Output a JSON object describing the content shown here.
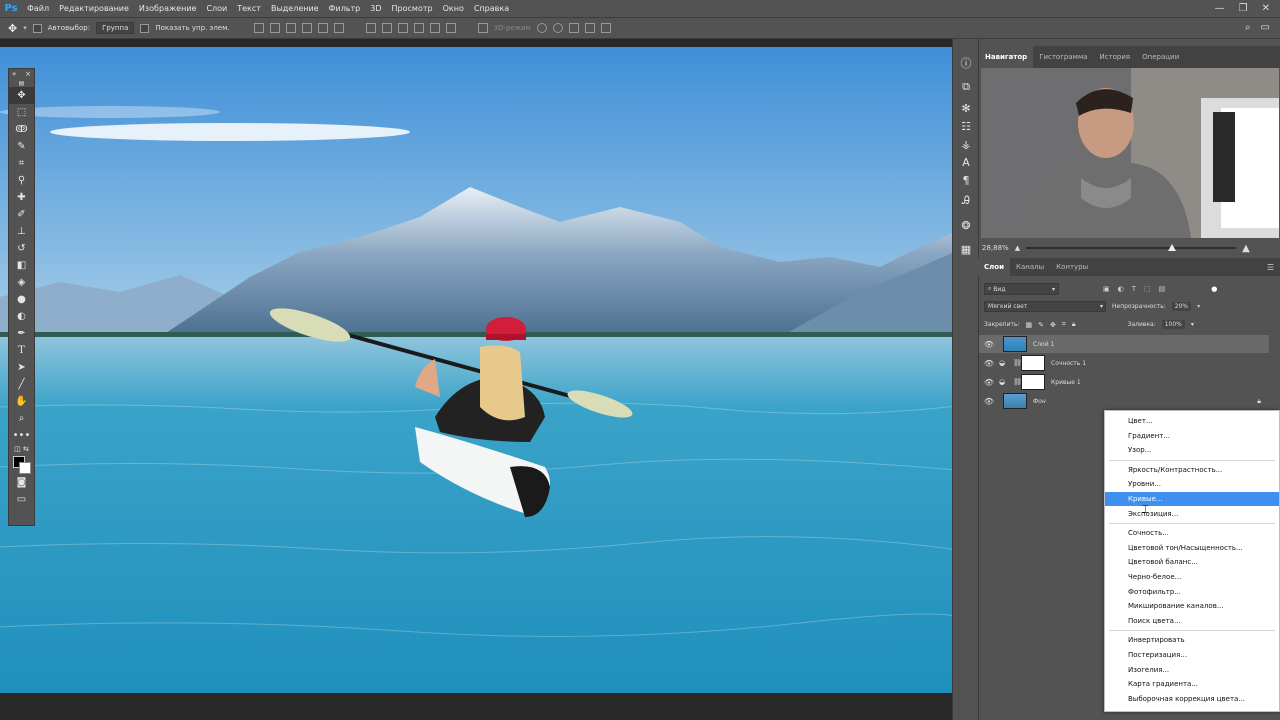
{
  "app": {
    "logo": "Ps"
  },
  "menu": [
    "Файл",
    "Редактирование",
    "Изображение",
    "Слои",
    "Текст",
    "Выделение",
    "Фильтр",
    "3D",
    "Просмотр",
    "Окно",
    "Справка"
  ],
  "window_controls": [
    "—",
    "❐",
    "✕"
  ],
  "options": {
    "autoselect_label": "Автовыбор:",
    "autoselect_value": "Группа",
    "show_controls_label": "Показать упр. элем.",
    "mode_3d": "3D-режим"
  },
  "navigator_tabs": [
    "Навигатор",
    "Гистограмма",
    "История",
    "Операции"
  ],
  "zoom": "28,88%",
  "layers_tabs": [
    "Слои",
    "Каналы",
    "Контуры"
  ],
  "layer_filter": "Вид",
  "blend_mode": "Мягкий свет",
  "opacity_label": "Непрозрачность:",
  "opacity_value": "20%",
  "lock_label": "Закрепить:",
  "fill_label": "Заливка:",
  "fill_value": "100%",
  "layers": [
    {
      "name": "Слой 1"
    },
    {
      "name": "Сочность 1"
    },
    {
      "name": "Кривые 1"
    },
    {
      "name": "Фон"
    }
  ],
  "adjustment_menu": [
    "Цвет...",
    "Градиент...",
    "Узор...",
    "Яркость/Контрастность...",
    "Уровни...",
    "Кривые...",
    "Экспозиция...",
    "Сочность...",
    "Цветовой тон/Насыщенность...",
    "Цветовой баланс...",
    "Черно-белое...",
    "Фотофильтр...",
    "Микширование каналов...",
    "Поиск цвета...",
    "Инвертировать",
    "Постеризация...",
    "Изогелия...",
    "Карта градиента...",
    "Выборочная коррекция цвета..."
  ],
  "highlighted_item": "Кривые...",
  "colors": {
    "accent": "#3f8ff0",
    "panel": "#535353",
    "dark": "#282828"
  }
}
